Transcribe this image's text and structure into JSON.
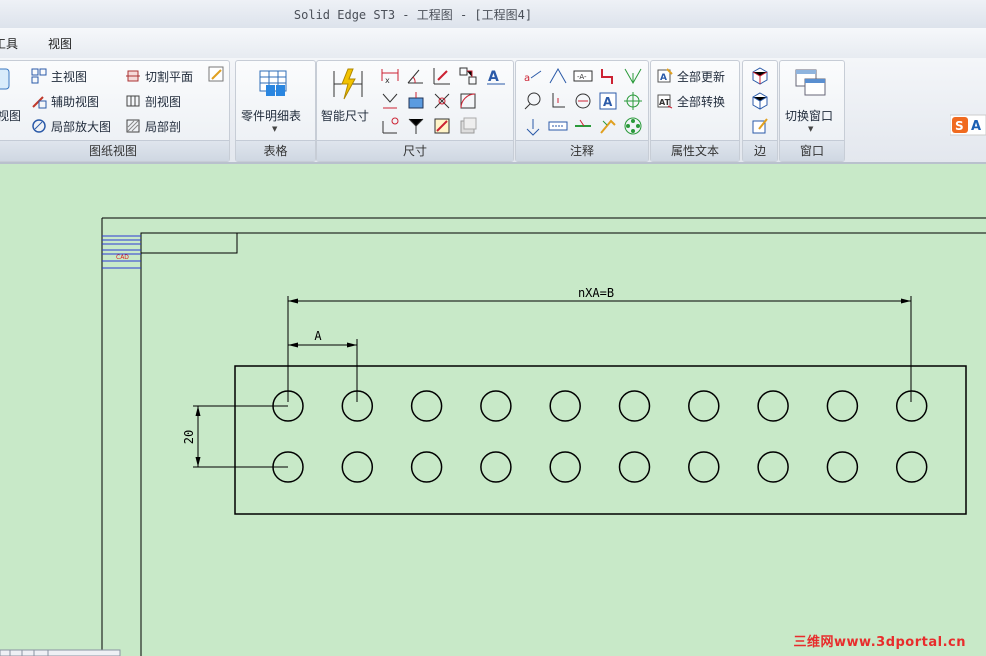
{
  "window": {
    "title": "Solid Edge ST3 - 工程图 - [工程图4]"
  },
  "menu": [
    {
      "label": "工具"
    },
    {
      "label": "视图"
    }
  ],
  "ribbon": {
    "drawing_views": {
      "group_label": "图纸视图",
      "partial_left_label": "视图",
      "buttons": [
        {
          "label": "主视图"
        },
        {
          "label": "辅助视图"
        },
        {
          "label": "局部放大图"
        },
        {
          "label": "切割平面"
        },
        {
          "label": "剖视图"
        },
        {
          "label": "局部剖"
        }
      ]
    },
    "tables": {
      "group_label": "表格",
      "big_button": "零件明细表"
    },
    "dimensions": {
      "group_label": "尺寸",
      "big_button": "智能尺寸"
    },
    "annotations": {
      "group_label": "注释"
    },
    "property_text": {
      "group_label": "属性文本",
      "update_all": "全部更新",
      "convert_all": "全部转换"
    },
    "edges": {
      "group_label": "边"
    },
    "window_group": {
      "group_label": "窗口",
      "switch_window": "切换窗口"
    }
  },
  "drawing": {
    "title_block_text": "CAD",
    "dim_total": "nXA=B",
    "dim_pitch": "A",
    "dim_row_spacing": "20",
    "hole_rows": 2,
    "hole_columns": 10
  },
  "watermark": "三维网www.3dportal.cn",
  "colors": {
    "canvas_bg": "#c8e9c8",
    "watermark": "#e82c2c",
    "title_block_lines": "#2c39d4"
  }
}
